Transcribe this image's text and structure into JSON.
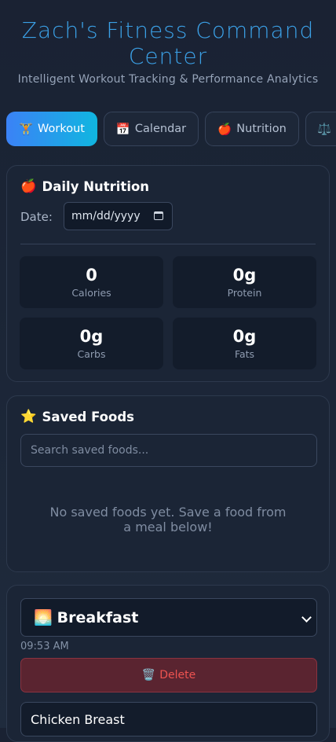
{
  "header": {
    "title": "Zach's Fitness Command Center",
    "subtitle": "Intelligent Workout Tracking & Performance Analytics"
  },
  "tabs": [
    {
      "icon": "🏋️",
      "label": "Workout",
      "active": true
    },
    {
      "icon": "📅",
      "label": "Calendar",
      "active": false
    },
    {
      "icon": "🍎",
      "label": "Nutrition",
      "active": false
    },
    {
      "icon": "⚖️",
      "label": "",
      "active": false
    }
  ],
  "daily_nutrition": {
    "icon": "🍎",
    "title": "Daily Nutrition",
    "date_label": "Date:",
    "date_value": "mm/dd/yyyy",
    "stats": [
      {
        "value": "0",
        "label": "Calories"
      },
      {
        "value": "0g",
        "label": "Protein"
      },
      {
        "value": "0g",
        "label": "Carbs"
      },
      {
        "value": "0g",
        "label": "Fats"
      }
    ]
  },
  "saved_foods": {
    "icon": "⭐",
    "title": "Saved Foods",
    "search_placeholder": "Search saved foods...",
    "empty_message": "No saved foods yet. Save a food from a meal below!"
  },
  "meal": {
    "icon": "🌅",
    "selected": "Breakfast",
    "time": "09:53 AM",
    "delete_icon": "🗑️",
    "delete_label": "Delete",
    "food_value": "Chicken Breast"
  },
  "colors": {
    "accent_title": "#3ba0e6",
    "active_tab_start": "#3b82f6",
    "active_tab_end": "#10b6e0",
    "danger": "#ef5350"
  }
}
